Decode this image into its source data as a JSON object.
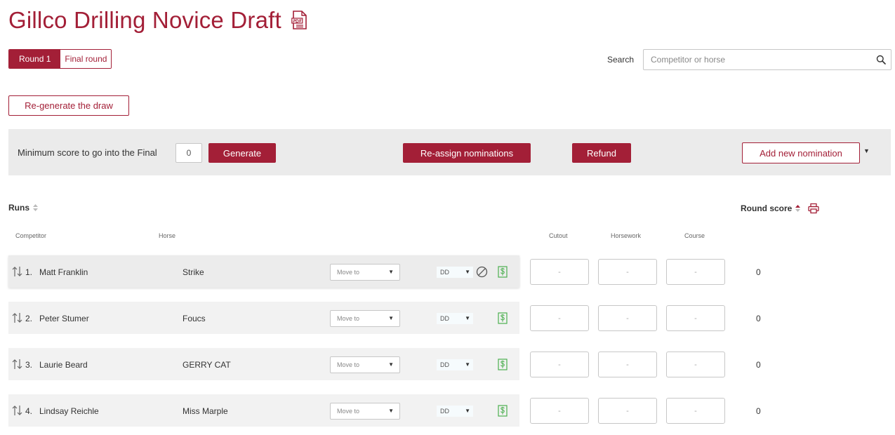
{
  "title": "Gillco Drilling Novice Draft",
  "rounds": [
    {
      "label": "Round 1",
      "active": true
    },
    {
      "label": "Final round",
      "active": false
    }
  ],
  "search": {
    "label": "Search",
    "placeholder": "Competitor or horse"
  },
  "regenerate_label": "Re-generate the draw",
  "action_bar": {
    "min_score_label": "Minimum score to go into the Final",
    "min_score_value": "0",
    "generate_label": "Generate",
    "reassign_label": "Re-assign nominations",
    "refund_label": "Refund",
    "add_nomination_label": "Add new nomination",
    "add_caret": "▼"
  },
  "table": {
    "runs_label": "Runs",
    "round_score_label": "Round score",
    "columns": {
      "competitor": "Competitor",
      "horse": "Horse",
      "cutout": "Cutout",
      "horsework": "Horsework",
      "course": "Course"
    },
    "rows": [
      {
        "num": "1.",
        "competitor": "Matt Franklin",
        "horse": "Strike",
        "move_to": "Move to",
        "dd": "DD",
        "caret": "▼",
        "cutout": "-",
        "horsework": "-",
        "course": "-",
        "round_score": "0"
      },
      {
        "num": "2.",
        "competitor": "Peter Stumer",
        "horse": "Foucs",
        "move_to": "Move to",
        "dd": "DD",
        "caret": "▼",
        "cutout": "-",
        "horsework": "-",
        "course": "-",
        "round_score": "0"
      },
      {
        "num": "3.",
        "competitor": "Laurie Beard",
        "horse": "GERRY CAT",
        "move_to": "Move to",
        "dd": "DD",
        "caret": "▼",
        "cutout": "-",
        "horsework": "-",
        "course": "-",
        "round_score": "0"
      },
      {
        "num": "4.",
        "competitor": "Lindsay Reichle",
        "horse": "Miss Marple",
        "move_to": "Move to",
        "dd": "DD",
        "caret": "▼",
        "cutout": "-",
        "horsework": "-",
        "course": "-",
        "round_score": "0"
      }
    ]
  },
  "icons": {
    "pdf": "pdf-file-icon",
    "search": "search-icon",
    "sort": "sort-icon",
    "sort_active": "sort-up-icon",
    "print": "print-icon",
    "drag": "drag-reorder-icon",
    "no_entry": "prohibited-icon",
    "money": "dollar-icon"
  },
  "colors": {
    "brand": "#a31f37",
    "bar_bg": "#ebebeb",
    "row_bg": "#f2f2f2",
    "money": "#4caf50"
  }
}
